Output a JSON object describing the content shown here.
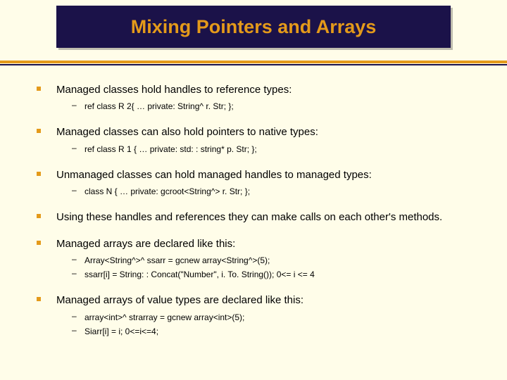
{
  "title": "Mixing Pointers and Arrays",
  "bullets": [
    {
      "text": "Managed classes hold handles to reference types:",
      "subs": [
        "ref class R 2{ … private: String^ r. Str; };"
      ]
    },
    {
      "text": "Managed classes can also hold pointers to native types:",
      "subs": [
        "ref class R 1 { … private: std: : string* p. Str; };"
      ]
    },
    {
      "text": "Unmanaged classes can hold managed handles to managed types:",
      "subs": [
        "class N { … private: gcroot<String^> r. Str; };"
      ]
    },
    {
      "text": "Using these handles and references they can make calls on each other's methods.",
      "subs": []
    },
    {
      "text": "Managed arrays are declared like this:",
      "subs": [
        "Array<String^>^ ssarr = gcnew array<String^>(5);",
        "ssarr[i] = String: : Concat(\"Number\", i. To. String());  0<= i <= 4"
      ]
    },
    {
      "text": "Managed arrays of value types are declared like this:",
      "subs": [
        "array<int>^ strarray = gcnew array<int>(5);",
        "Siarr[i] = i;  0<=i<=4;"
      ]
    }
  ]
}
